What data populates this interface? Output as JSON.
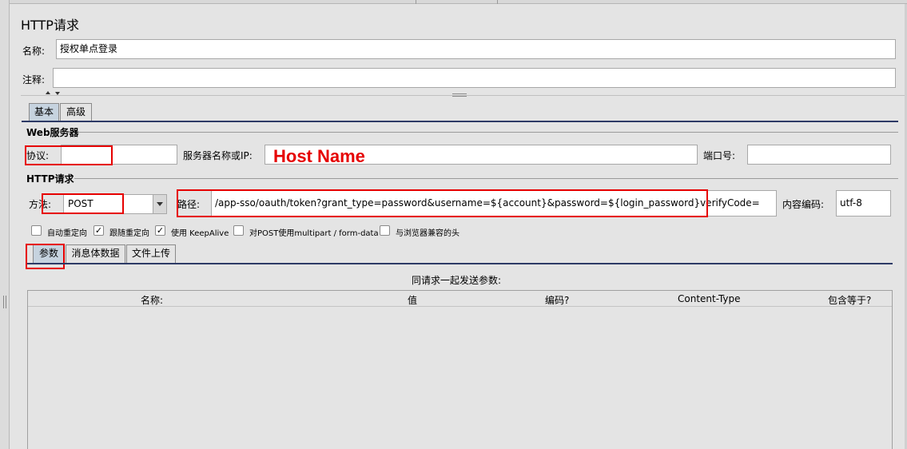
{
  "panel": {
    "title": "HTTP请求",
    "name_label": "名称:",
    "name_value": "授权单点登录",
    "comment_label": "注释:",
    "comment_value": ""
  },
  "tabs": [
    {
      "label": "基本",
      "active": true
    },
    {
      "label": "高级",
      "active": false
    }
  ],
  "web_server": {
    "section_title": "Web服务器",
    "protocol_label": "协议:",
    "protocol_value": "",
    "server_label": "服务器名称或IP:",
    "server_value": "",
    "annotation": "Host Name",
    "port_label": "端口号:",
    "port_value": ""
  },
  "http_request": {
    "section_title": "HTTP请求",
    "method_label": "方法:",
    "method_value": "POST",
    "path_label": "路径:",
    "path_value": "/app-sso/oauth/token?grant_type=password&username=${account}&password=${login_password}verifyCode=",
    "encoding_label": "内容编码:",
    "encoding_value": "utf-8"
  },
  "options": [
    {
      "label": "自动重定向",
      "checked": false
    },
    {
      "label": "跟随重定向",
      "checked": true
    },
    {
      "label": "使用 KeepAlive",
      "checked": true
    },
    {
      "label": "对POST使用multipart / form-data",
      "checked": false
    },
    {
      "label": "与浏览器兼容的头",
      "checked": false
    }
  ],
  "body_tabs": [
    {
      "label": "参数",
      "active": true
    },
    {
      "label": "消息体数据",
      "active": false
    },
    {
      "label": "文件上传",
      "active": false
    }
  ],
  "params": {
    "caption": "同请求一起发送参数:",
    "columns": [
      "名称:",
      "值",
      "编码?",
      "Content-Type",
      "包含等于?"
    ]
  },
  "colors": {
    "background": "#e4e4e4",
    "highlight": "#e60000",
    "rule": "#2d3a66",
    "active_tab": "#c6d3df"
  }
}
